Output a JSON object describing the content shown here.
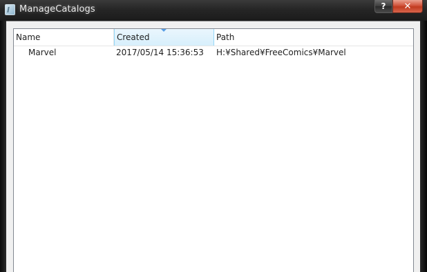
{
  "window": {
    "title": "ManageCatalogs",
    "help_label": "?",
    "close_label": "✕"
  },
  "listview": {
    "columns": [
      "Name",
      "Created",
      "Path"
    ],
    "sorted_column": "Created",
    "rows": [
      {
        "name": "Marvel",
        "created": "2017/05/14 15:36:53",
        "path": "H:¥Shared¥FreeComics¥Marvel"
      }
    ]
  },
  "colors": {
    "titlebar": "#262626",
    "close_button": "#c7432a",
    "selected_header": "#d7effc",
    "client_bg": "#f0f0f0"
  },
  "icons": [
    "app-icon",
    "help-icon",
    "close-icon",
    "sort-descending-icon"
  ]
}
